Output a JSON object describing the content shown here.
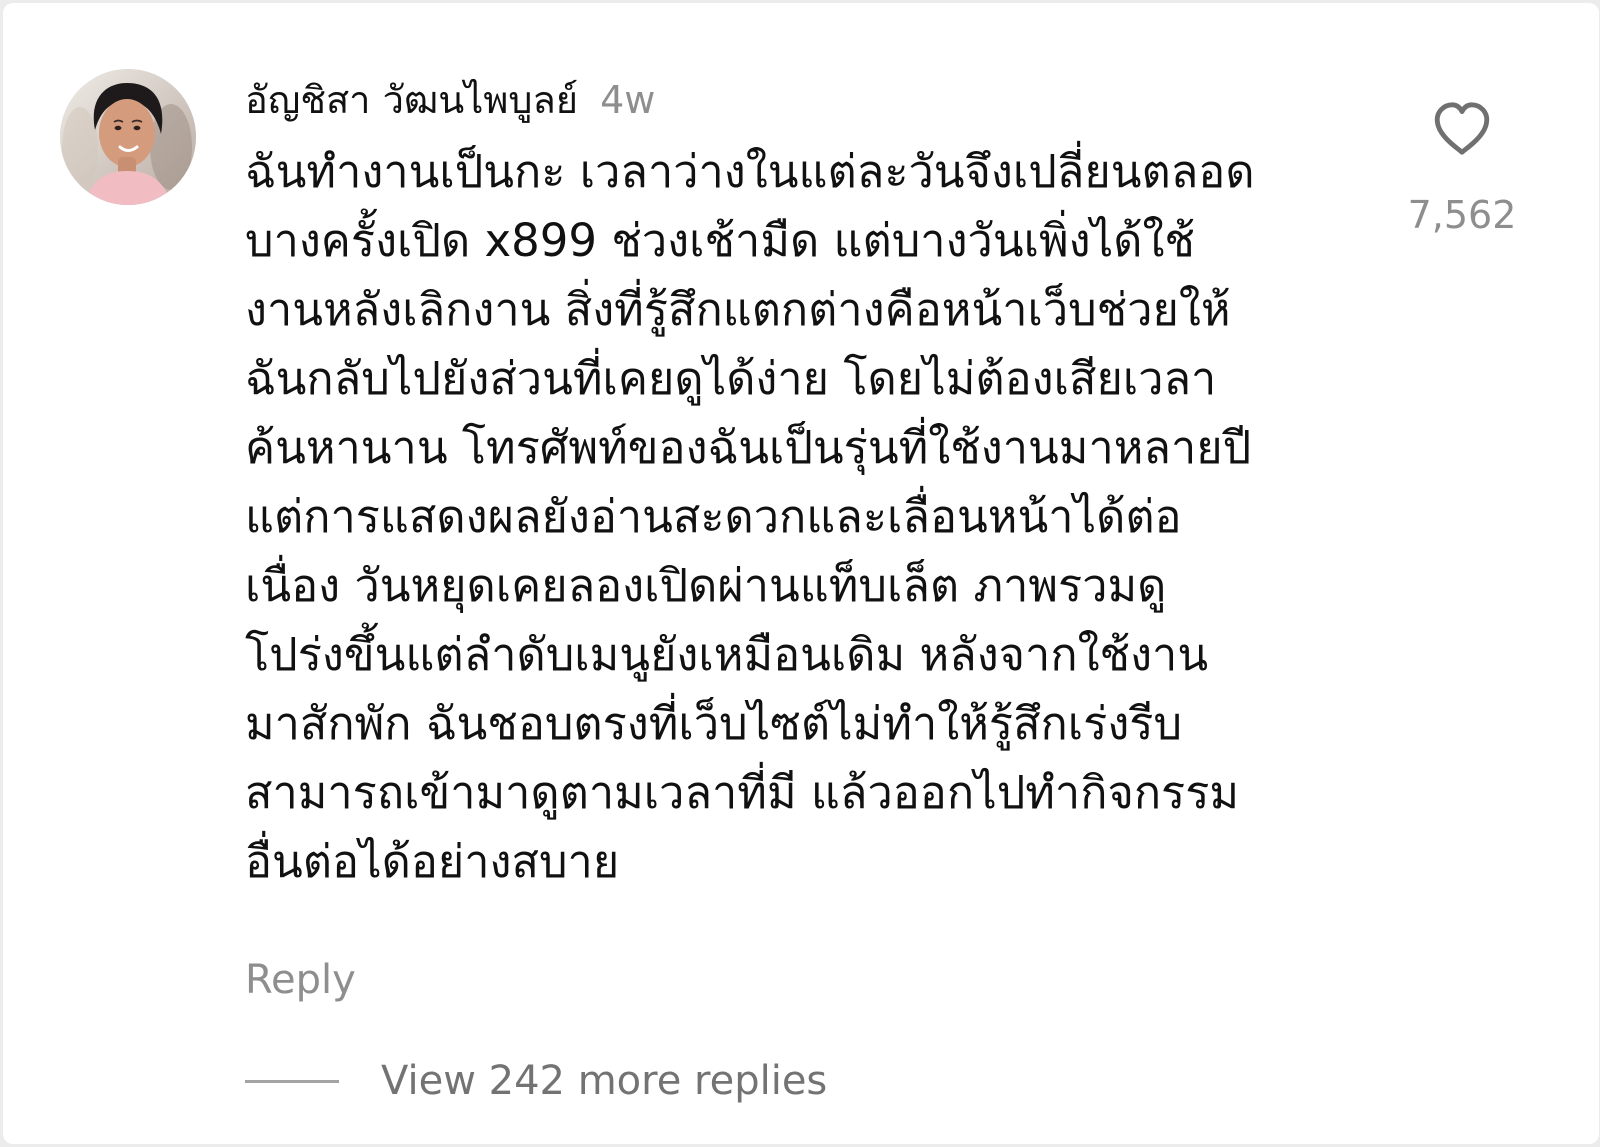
{
  "comment": {
    "username": "อัญชิสา วัฒนไพบูลย์",
    "time_ago": "4w",
    "text": "ฉันทำงานเป็นกะ เวลาว่างในแต่ละวันจึงเปลี่ยนตลอด\nบางครั้งเปิด x899 ช่วงเช้ามืด แต่บางวันเพิ่งได้ใช้\nงานหลังเลิกงาน สิ่งที่รู้สึกแตกต่างคือหน้าเว็บช่วยให้\nฉันกลับไปยังส่วนที่เคยดูได้ง่าย โดยไม่ต้องเสียเวลา\nค้นหานาน โทรศัพท์ของฉันเป็นรุ่นที่ใช้งานมาหลายปี\nแต่การแสดงผลยังอ่านสะดวกและเลื่อนหน้าได้ต่อ\nเนื่อง วันหยุดเคยลองเปิดผ่านแท็บเล็ต ภาพรวมดู\nโปร่งขึ้นแต่ลำดับเมนูยังเหมือนเดิม หลังจากใช้งาน\nมาสักพัก ฉันชอบตรงที่เว็บไซต์ไม่ทำให้รู้สึกเร่งรีบ\nสามารถเข้ามาดูตามเวลาที่มี แล้วออกไปทำกิจกรรม\nอื่นต่อได้อย่างสบาย",
    "reply_label": "Reply",
    "view_replies_label": "View 242 more replies",
    "like_count": "7,562"
  },
  "icons": {
    "like": "heart-outline-icon",
    "avatar": "profile-photo"
  },
  "colors": {
    "primary_text": "#111111",
    "secondary_text": "#8e8e8e",
    "line": "#a4a4a4",
    "background": "#ffffff"
  }
}
